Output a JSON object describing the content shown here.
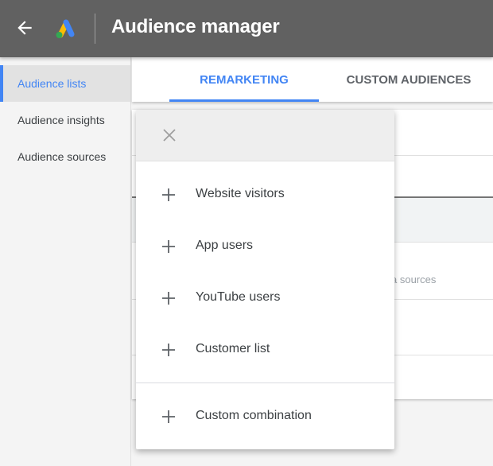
{
  "header": {
    "title": "Audience manager",
    "back_icon": "arrow-left-icon",
    "logo": "google-ads-logo",
    "logo_colors": {
      "blue": "#4285f4",
      "yellow": "#fbbc04",
      "green": "#34a853"
    }
  },
  "sidebar": {
    "items": [
      {
        "label": "Audience lists",
        "active": true
      },
      {
        "label": "Audience insights",
        "active": false
      },
      {
        "label": "Audience sources",
        "active": false
      }
    ]
  },
  "tabs": [
    {
      "label": "REMARKETING",
      "active": true
    },
    {
      "label": "CUSTOM AUDIENCES",
      "active": false
    }
  ],
  "background_card": {
    "partial_text": "a sources"
  },
  "popup": {
    "close_icon": "close-icon",
    "items": [
      {
        "label": "Website visitors",
        "icon": "plus-icon"
      },
      {
        "label": "App users",
        "icon": "plus-icon"
      },
      {
        "label": "YouTube users",
        "icon": "plus-icon"
      },
      {
        "label": "Customer list",
        "icon": "plus-icon"
      },
      {
        "label": "Custom combination",
        "icon": "plus-icon"
      }
    ]
  },
  "colors": {
    "header_bg": "#616161",
    "accent": "#4285f4",
    "sidebar_bg": "#f4f4f4",
    "sidebar_active_bg": "#e2e2e2"
  }
}
